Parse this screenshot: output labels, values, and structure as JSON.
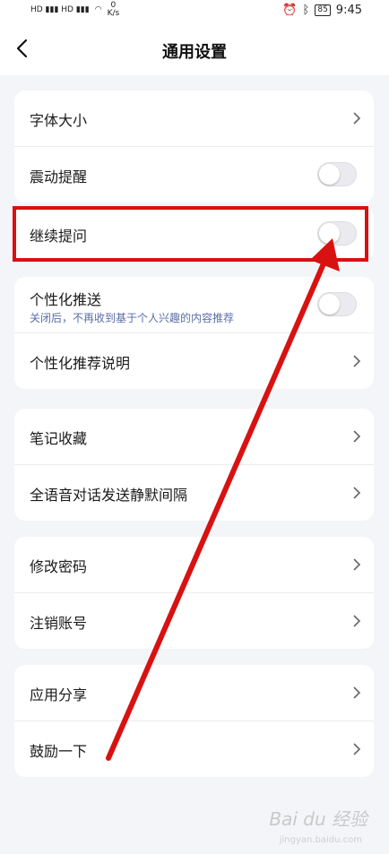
{
  "status_bar": {
    "net_speed_value": "0",
    "net_speed_unit": "K/s",
    "battery": "85",
    "time": "9:45"
  },
  "nav": {
    "title": "通用设置"
  },
  "groups": [
    {
      "rows": [
        {
          "label": "字体大小",
          "control": "chevron"
        },
        {
          "label": "震动提醒",
          "control": "toggle",
          "on": false
        }
      ]
    },
    {
      "rows": [
        {
          "label": "继续提问",
          "control": "toggle",
          "on": false
        }
      ]
    },
    {
      "rows": [
        {
          "label": "个性化推送",
          "subtitle": "关闭后，不再收到基于个人兴趣的内容推荐",
          "control": "toggle",
          "on": false
        },
        {
          "label": "个性化推荐说明",
          "control": "chevron"
        }
      ]
    },
    {
      "rows": [
        {
          "label": "笔记收藏",
          "control": "chevron"
        },
        {
          "label": "全语音对话发送静默间隔",
          "control": "chevron"
        }
      ]
    },
    {
      "rows": [
        {
          "label": "修改密码",
          "control": "chevron"
        },
        {
          "label": "注销账号",
          "control": "chevron"
        }
      ]
    },
    {
      "rows": [
        {
          "label": "应用分享",
          "control": "chevron"
        },
        {
          "label": "鼓励一下",
          "control": "chevron"
        }
      ]
    }
  ],
  "watermark": {
    "text": "Bai du 经验",
    "sub": "jingyan.baidu.com"
  },
  "colors": {
    "background": "#f4f5f9",
    "annotation_red": "#d81111",
    "subtitle": "#5a6ea6"
  }
}
